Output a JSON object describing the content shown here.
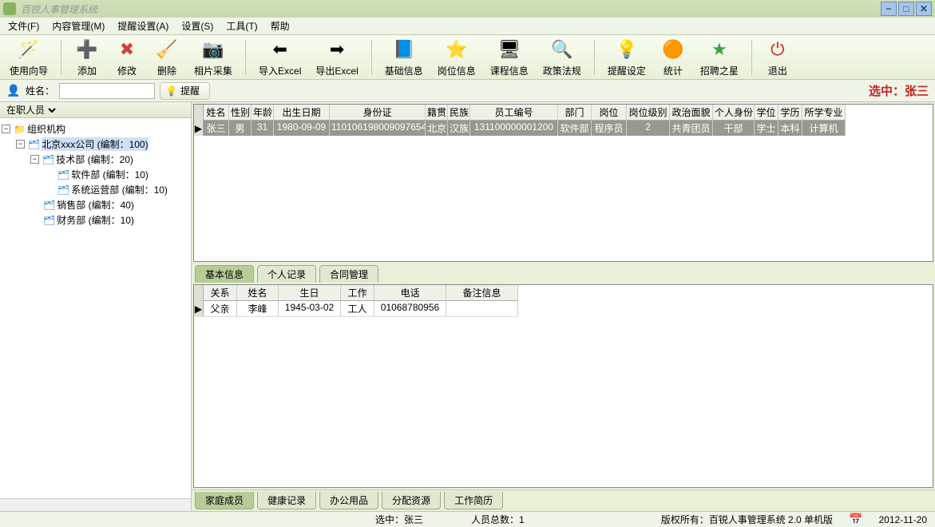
{
  "app_title": "百锐人事管理系统",
  "menus": [
    "文件(F)",
    "内容管理(M)",
    "提醒设置(A)",
    "设置(S)",
    "工具(T)",
    "帮助"
  ],
  "toolbar": [
    {
      "label": "使用向导",
      "icon": "🪄"
    },
    {
      "label": "添加",
      "icon": "➕",
      "color": "#4ab04a"
    },
    {
      "label": "修改",
      "icon": "✖",
      "color": "#d04040"
    },
    {
      "label": "删除",
      "icon": "🧹"
    },
    {
      "label": "相片采集",
      "icon": "📷"
    },
    {
      "label": "导入Excel",
      "icon": "⬅"
    },
    {
      "label": "导出Excel",
      "icon": "➡"
    },
    {
      "label": "基础信息",
      "icon": "📘"
    },
    {
      "label": "岗位信息",
      "icon": "⭐"
    },
    {
      "label": "课程信息",
      "icon": "🖥"
    },
    {
      "label": "政策法规",
      "icon": "🔍"
    },
    {
      "label": "提醒设定",
      "icon": "💡"
    },
    {
      "label": "统计",
      "icon": "🟠"
    },
    {
      "label": "招聘之星",
      "icon": "★",
      "color": "#40a040"
    },
    {
      "label": "退出",
      "icon": "⏻",
      "color": "#d02020"
    }
  ],
  "filter": {
    "name_label": "姓名：",
    "name_value": "",
    "remind_btn": "提醒"
  },
  "selected_text": "选中：张三",
  "sidebar": {
    "dropdown": "在职人员",
    "tree_root": "组织机构",
    "company": "北京xxx公司 (编制：100)",
    "dept_tech": "技术部 (编制：20)",
    "dept_soft": "软件部 (编制：10)",
    "dept_ops": "系统运营部 (编制：10)",
    "dept_sales": "销售部 (编制：40)",
    "dept_fin": "财务部 (编制：10)"
  },
  "grid_top": {
    "cols": [
      "姓名",
      "性别",
      "年龄",
      "出生日期",
      "身份证",
      "籍贯",
      "民族",
      "员工编号",
      "部门",
      "岗位",
      "岗位级别",
      "政治面貌",
      "个人身份",
      "学位",
      "学历",
      "所学专业"
    ],
    "widths": [
      32,
      28,
      28,
      70,
      120,
      28,
      28,
      110,
      42,
      44,
      54,
      54,
      52,
      30,
      30,
      54
    ],
    "row": [
      "张三",
      "男",
      "31",
      "1980-09-09",
      "110106198009097654",
      "北京",
      "汉族",
      "131100000001200",
      "软件部",
      "程序员",
      "2",
      "共青团员",
      "干部",
      "学士",
      "本科",
      "计算机"
    ]
  },
  "tabs_upper": [
    "基本信息",
    "个人记录",
    "合同管理"
  ],
  "grid_bottom": {
    "cols": [
      "关系",
      "姓名",
      "生日",
      "工作",
      "电话",
      "备注信息"
    ],
    "widths": [
      42,
      52,
      78,
      42,
      90,
      90
    ],
    "row": [
      "父亲",
      "李峰",
      "1945-03-02",
      "工人",
      "01068780956",
      ""
    ]
  },
  "tabs_lower": [
    "家庭成员",
    "健康记录",
    "办公用品",
    "分配资源",
    "工作简历"
  ],
  "status": {
    "selected": "选中：张三",
    "count": "人员总数：1",
    "copyright": "版权所有：百锐人事管理系统 2.0 单机版",
    "date": "2012-11-20"
  }
}
